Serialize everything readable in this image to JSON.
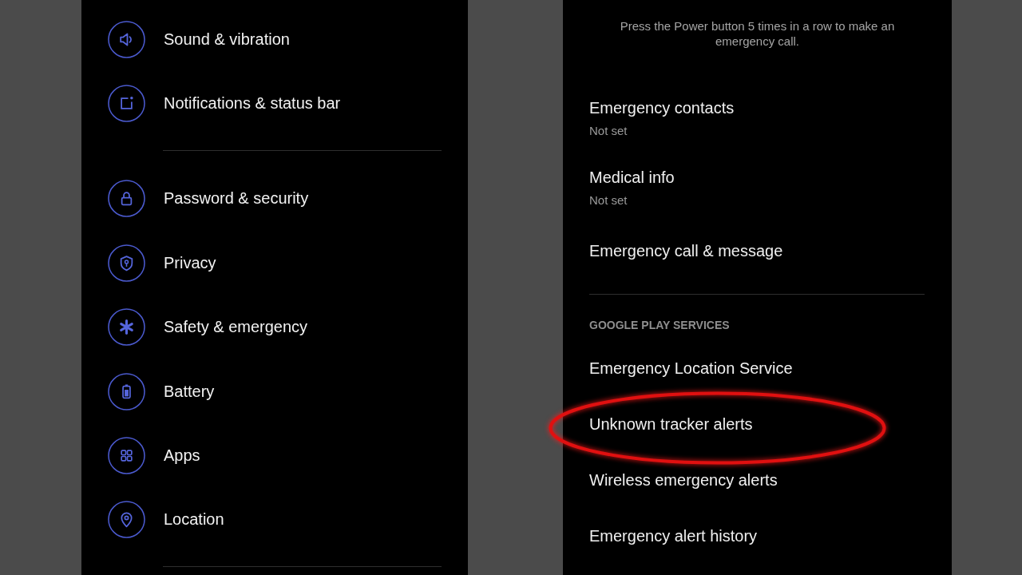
{
  "left_panel": {
    "sections": [
      {
        "items": [
          {
            "label": "Sound & vibration"
          },
          {
            "label": "Notifications & status bar"
          }
        ]
      },
      {
        "items": [
          {
            "label": "Password & security"
          },
          {
            "label": "Privacy"
          },
          {
            "label": "Safety & emergency"
          },
          {
            "label": "Battery"
          },
          {
            "label": "Apps"
          },
          {
            "label": "Location"
          }
        ]
      }
    ]
  },
  "right_panel": {
    "sections": [
      {
        "description": "Press the Power button 5 times in a row to make an emergency call.",
        "items": [
          {
            "title": "Emergency contacts",
            "summary": "Not set",
            "highlighted": false
          },
          {
            "title": "Medical info",
            "summary": "Not set",
            "highlighted": false
          },
          {
            "title": "Emergency call & message",
            "highlighted": false
          }
        ]
      },
      {
        "header": "GOOGLE PLAY SERVICES",
        "items": [
          {
            "title": "Emergency Location Service",
            "highlighted": false
          },
          {
            "title": "Unknown tracker alerts",
            "highlighted": true
          },
          {
            "title": "Wireless emergency alerts",
            "highlighted": false
          },
          {
            "title": "Emergency alert history",
            "highlighted": false
          }
        ]
      }
    ]
  }
}
